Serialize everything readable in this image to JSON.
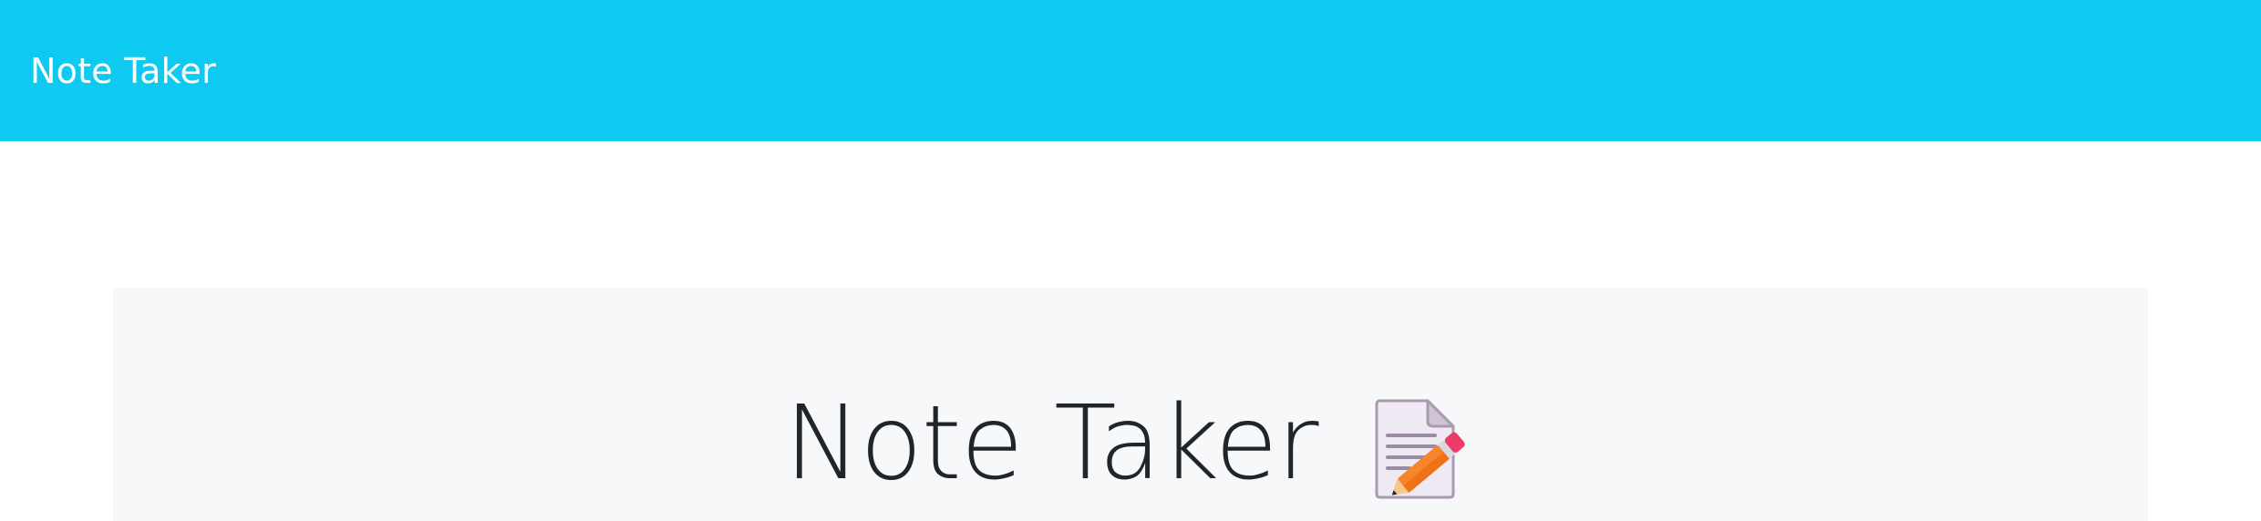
{
  "navbar": {
    "brand": "Note Taker",
    "background": "#0fcaf0"
  },
  "hero": {
    "title": "Note Taker",
    "icon": "memo-pencil-icon",
    "background": "#f7f8fa"
  }
}
